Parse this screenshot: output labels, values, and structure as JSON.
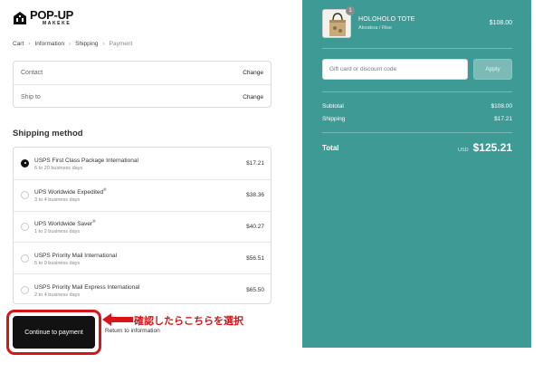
{
  "brand": {
    "name": "POP-UP",
    "sub": "MAKEKE"
  },
  "breadcrumb": [
    {
      "label": "Cart"
    },
    {
      "label": "Information"
    },
    {
      "label": "Shipping"
    },
    {
      "label": "Payment"
    }
  ],
  "breadcrumb_sep": "›",
  "info": {
    "contact_label": "Contact",
    "contact_change": "Change",
    "ship_label": "Ship to",
    "ship_change": "Change"
  },
  "shipping": {
    "title": "Shipping method",
    "methods": [
      {
        "name": "USPS First Class Package International",
        "mark": "",
        "days": "6 to 20 business days",
        "price": "$17.21",
        "selected": true
      },
      {
        "name": "UPS Worldwide Expedited",
        "mark": "®",
        "days": "3 to 4 business days",
        "price": "$38.36",
        "selected": false
      },
      {
        "name": "UPS Worldwide Saver",
        "mark": "®",
        "days": "1 to 2 business days",
        "price": "$40.27",
        "selected": false
      },
      {
        "name": "USPS Priority Mail International",
        "mark": "",
        "days": "5 to 9 business days",
        "price": "$56.51",
        "selected": false
      },
      {
        "name": "USPS Priority Mail Express International",
        "mark": "",
        "days": "2 to 4 business days",
        "price": "$65.50",
        "selected": false
      }
    ]
  },
  "actions": {
    "continue": "Continue to payment",
    "return": "Return to information"
  },
  "annotation": {
    "text": "確認したらこちらを選択",
    "color": "#d7141a"
  },
  "summary": {
    "bg_color": "#3e9a95",
    "product": {
      "name": "HOLOHOLO TOTE",
      "variant": "Akoakoa / Rise",
      "price": "$108.00",
      "qty": "1"
    },
    "discount": {
      "placeholder": "Gift card or discount code",
      "value": "",
      "apply": "Apply"
    },
    "subtotal_label": "Subtotal",
    "subtotal": "$108.00",
    "shipping_label": "Shipping",
    "shipping": "$17.21",
    "total_label": "Total",
    "currency": "USD",
    "total": "$125.21"
  },
  "icons": {
    "logo": "popup-logo-icon",
    "arrow": "red-arrow-icon",
    "radio": "radio-icon"
  }
}
